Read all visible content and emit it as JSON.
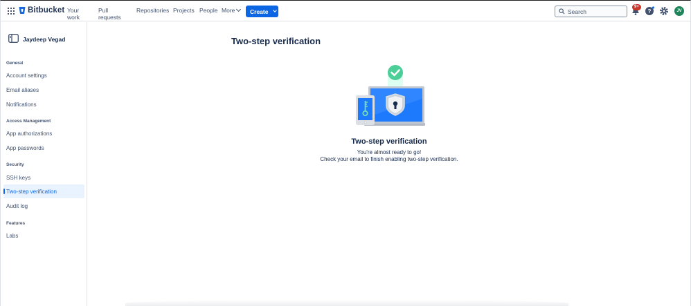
{
  "brand": {
    "name": "Bitbucket",
    "accent": "#0c66e4"
  },
  "nav": {
    "links": [
      "Your work",
      "Pull requests",
      "Repositories",
      "Projects",
      "People",
      "More"
    ],
    "create_label": "Create",
    "search_placeholder": "Search",
    "notification_badge": "9+",
    "avatar_initials": "JV"
  },
  "icons": {
    "apps": "app-switcher-icon",
    "logo": "bitbucket-logo",
    "search": "search-icon",
    "bell": "bell-icon",
    "help": "help-icon",
    "settings": "gear-icon",
    "sidebar_user": "sidebar-panel-icon",
    "illustration": "two-step-verification-illustration"
  },
  "sidebar": {
    "user_name": "Jaydeep Vegad",
    "groups": [
      {
        "heading": "General",
        "items": [
          "Account settings",
          "Email aliases",
          "Notifications"
        ]
      },
      {
        "heading": "Access Management",
        "items": [
          "App authorizations",
          "App passwords"
        ]
      },
      {
        "heading": "Security",
        "items": [
          "SSH keys",
          "Two-step verification",
          "Audit log"
        ]
      },
      {
        "heading": "Features",
        "items": [
          "Labs"
        ]
      }
    ],
    "active_item": "Two-step verification"
  },
  "main": {
    "page_title": "Two-step verification",
    "heading": "Two-step verification",
    "line1": "You're almost ready to go!",
    "line2": "Check your email to finish enabling two-step verification."
  }
}
